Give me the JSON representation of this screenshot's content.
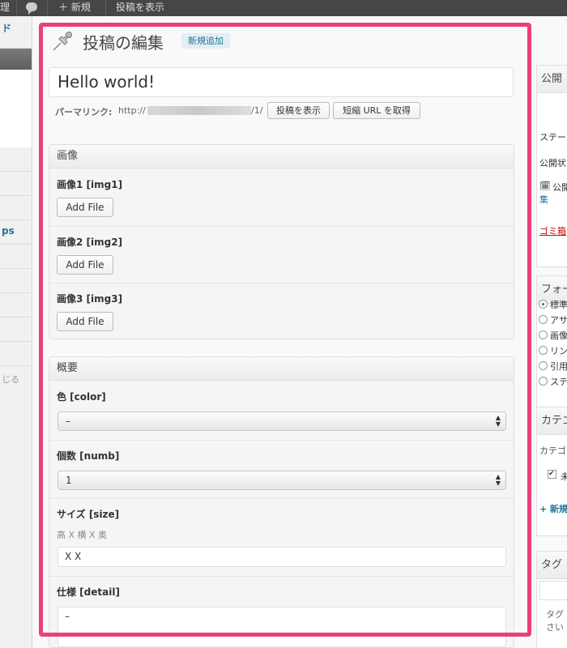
{
  "admin_bar": {
    "frag_left": "理",
    "new_label": "＋ 新規",
    "view_post_label": "投稿を表示"
  },
  "left_menu": {
    "item1": "ド",
    "item2": "ps",
    "close": "じる"
  },
  "header": {
    "title": "投稿の編集",
    "add_new": "新規追加"
  },
  "post": {
    "title": "Hello world!",
    "permalink_label": "パーマリンク:",
    "permalink_prefix": "http://",
    "permalink_suffix": "/1/",
    "view_post_button": "投稿を表示",
    "shortlink_button": "短縮 URL を取得"
  },
  "images_box": {
    "title": "画像",
    "fields": [
      {
        "label": "画像1 [img1]",
        "button": "Add File"
      },
      {
        "label": "画像2 [img2]",
        "button": "Add File"
      },
      {
        "label": "画像3 [img3]",
        "button": "Add File"
      }
    ]
  },
  "overview_box": {
    "title": "概要",
    "color": {
      "label": "色 [color]",
      "value": "–"
    },
    "numb": {
      "label": "個数 [numb]",
      "value": "1"
    },
    "size": {
      "label": "サイズ [size]",
      "hint": "高 X 横 X 奥",
      "value": "X X"
    },
    "detail": {
      "label": "仕様 [detail]",
      "value": "–"
    }
  },
  "sidebar": {
    "publish": "公開",
    "status": "ステー",
    "visibility": "公開状",
    "schedule": "公開",
    "schedule_link": "集",
    "trash": "ゴミ箱",
    "format": "フォー",
    "format_options": [
      "標準",
      "アサ",
      "画像",
      "リン",
      "引用",
      "ステ"
    ],
    "categories": "カテゴ",
    "categories_tab": "カテゴ",
    "category_item": "未",
    "add_new_category": "+ 新規",
    "tags": "タグ",
    "tags_hint1": "タグ",
    "tags_hint2": "さい"
  },
  "colors": {
    "highlight": "#ed3e7c",
    "link": "#21759b",
    "trash": "#bc0b0b"
  }
}
